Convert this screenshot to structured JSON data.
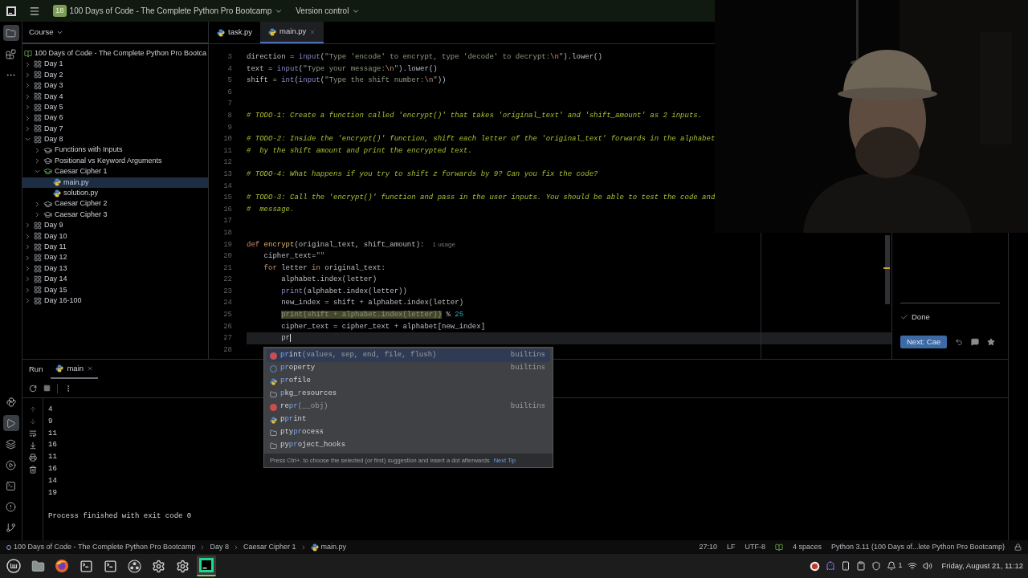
{
  "title_bar": {
    "project_badge": "18",
    "project": "100 Days of Code - The Complete Python Pro Bootcamp",
    "vcs": "Version control"
  },
  "left_rail": {
    "top": [
      {
        "kind": "project",
        "selected": true
      },
      {
        "kind": "structure",
        "selected": false
      },
      {
        "kind": "more",
        "selected": false
      }
    ],
    "bottom": [
      {
        "kind": "python-console",
        "selected": false
      },
      {
        "kind": "run",
        "selected": true
      },
      {
        "kind": "layers",
        "selected": false
      },
      {
        "kind": "services",
        "selected": false
      },
      {
        "kind": "terminal",
        "selected": false
      },
      {
        "kind": "problems",
        "selected": false
      },
      {
        "kind": "git",
        "selected": false
      }
    ]
  },
  "project_panel": {
    "title": "Course",
    "tree": [
      {
        "kind": "course",
        "label": "100 Days of Code - The Complete Python Pro Bootca",
        "selected": false,
        "children": [
          {
            "kind": "section",
            "label": "Day 1",
            "expanded": false,
            "selected": false
          },
          {
            "kind": "section",
            "label": "Day 2",
            "expanded": false,
            "selected": false
          },
          {
            "kind": "section",
            "label": "Day 3",
            "expanded": false,
            "selected": false
          },
          {
            "kind": "section",
            "label": "Day 4",
            "expanded": false,
            "selected": false
          },
          {
            "kind": "section",
            "label": "Day 5",
            "expanded": false,
            "selected": false
          },
          {
            "kind": "section",
            "label": "Day 6",
            "expanded": false,
            "selected": false
          },
          {
            "kind": "section",
            "label": "Day 7",
            "expanded": false,
            "selected": false
          },
          {
            "kind": "section",
            "label": "Day 8",
            "expanded": true,
            "selected": false,
            "children": [
              {
                "kind": "lesson",
                "label": "Functions with Inputs",
                "expanded": false,
                "solved": false,
                "selected": false
              },
              {
                "kind": "lesson",
                "label": "Positional vs Keyword Arguments",
                "expanded": false,
                "solved": false,
                "selected": false
              },
              {
                "kind": "lesson",
                "label": "Caesar Cipher 1",
                "expanded": true,
                "solved": true,
                "selected": false,
                "children": [
                  {
                    "kind": "file",
                    "label": "main.py",
                    "selected": true
                  },
                  {
                    "kind": "file",
                    "label": "solution.py",
                    "selected": false
                  }
                ]
              },
              {
                "kind": "lesson",
                "label": "Caesar Cipher 2",
                "expanded": false,
                "solved": false,
                "selected": false
              },
              {
                "kind": "lesson",
                "label": "Caesar Cipher 3",
                "expanded": false,
                "solved": false,
                "selected": false
              }
            ]
          },
          {
            "kind": "section",
            "label": "Day 9",
            "expanded": false,
            "selected": false
          },
          {
            "kind": "section",
            "label": "Day 10",
            "expanded": false,
            "selected": false
          },
          {
            "kind": "section",
            "label": "Day 11",
            "expanded": false,
            "selected": false
          },
          {
            "kind": "section",
            "label": "Day 12",
            "expanded": false,
            "selected": false
          },
          {
            "kind": "section",
            "label": "Day 13",
            "expanded": false,
            "selected": false
          },
          {
            "kind": "section",
            "label": "Day 14",
            "expanded": false,
            "selected": false
          },
          {
            "kind": "section",
            "label": "Day 15",
            "expanded": false,
            "selected": false
          },
          {
            "kind": "section",
            "label": "Day 16-100",
            "expanded": false,
            "selected": false
          }
        ]
      }
    ]
  },
  "editor": {
    "tabs": [
      {
        "label": "task.py",
        "selected": false
      },
      {
        "label": "main.py",
        "selected": true
      }
    ],
    "lines": [
      {
        "number": "3",
        "current": false,
        "tokens": [
          {
            "text": "direction = ",
            "kind": "plain"
          },
          {
            "text": "input",
            "kind": "builtin"
          },
          {
            "text": "(",
            "kind": "plain"
          },
          {
            "text": "\"Type 'encode' to encrypt, type 'decode' to decrypt:",
            "kind": "string"
          },
          {
            "text": "\\n",
            "kind": "escape"
          },
          {
            "text": "\"",
            "kind": "string"
          },
          {
            "text": ").lower()",
            "kind": "plain"
          }
        ]
      },
      {
        "number": "4",
        "current": false,
        "tokens": [
          {
            "text": "text = ",
            "kind": "plain"
          },
          {
            "text": "input",
            "kind": "builtin"
          },
          {
            "text": "(",
            "kind": "plain"
          },
          {
            "text": "\"Type your message:",
            "kind": "string"
          },
          {
            "text": "\\n",
            "kind": "escape"
          },
          {
            "text": "\"",
            "kind": "string"
          },
          {
            "text": ").lower()",
            "kind": "plain"
          }
        ]
      },
      {
        "number": "5",
        "current": false,
        "tokens": [
          {
            "text": "shift = ",
            "kind": "plain"
          },
          {
            "text": "int",
            "kind": "builtin"
          },
          {
            "text": "(",
            "kind": "plain"
          },
          {
            "text": "input",
            "kind": "builtin"
          },
          {
            "text": "(",
            "kind": "plain"
          },
          {
            "text": "\"Type the shift number:",
            "kind": "string"
          },
          {
            "text": "\\n",
            "kind": "escape"
          },
          {
            "text": "\"",
            "kind": "string"
          },
          {
            "text": "))",
            "kind": "plain"
          }
        ]
      },
      {
        "number": "6",
        "current": false
      },
      {
        "number": "7",
        "current": false
      },
      {
        "number": "8",
        "current": false,
        "tokens": [
          {
            "text": "# TODO-1: Create a function called 'encrypt()' that takes 'original_text' and 'shift_amount' as 2 inputs.",
            "kind": "comment"
          }
        ]
      },
      {
        "number": "9",
        "current": false
      },
      {
        "number": "10",
        "current": false,
        "tokens": [
          {
            "text": "# TODO-2: Inside the 'encrypt()' function, shift each letter of the 'original_text' forwards in the alphabet",
            "kind": "comment"
          }
        ]
      },
      {
        "number": "11",
        "current": false,
        "tokens": [
          {
            "text": "#  by the shift amount and print the encrypted text.",
            "kind": "comment"
          }
        ]
      },
      {
        "number": "12",
        "current": false
      },
      {
        "number": "13",
        "current": false,
        "tokens": [
          {
            "text": "# TODO-4: What happens if you try to shift z forwards by 9? Can you fix the code?",
            "kind": "comment"
          }
        ]
      },
      {
        "number": "14",
        "current": false
      },
      {
        "number": "15",
        "current": false,
        "tokens": [
          {
            "text": "# TODO-3: Call the 'encrypt()' function and pass in the user inputs. You should be able to test the code and",
            "kind": "comment"
          }
        ]
      },
      {
        "number": "16",
        "current": false,
        "tokens": [
          {
            "text": "#  message.",
            "kind": "comment"
          }
        ]
      },
      {
        "number": "17",
        "current": false
      },
      {
        "number": "18",
        "current": false
      },
      {
        "number": "19",
        "current": false,
        "tokens": [
          {
            "text": "def",
            "kind": "keyword"
          },
          {
            "text": " encrypt",
            "kind": "defname"
          },
          {
            "text": "(original_text, shift_amount):",
            "kind": "plain"
          },
          {
            "text": "1 usage",
            "kind": "hint"
          }
        ]
      },
      {
        "number": "20",
        "current": false,
        "tokens": [
          {
            "text": "    cipher_text=",
            "kind": "plain"
          },
          {
            "text": "\"\"",
            "kind": "string"
          }
        ]
      },
      {
        "number": "21",
        "current": false,
        "tokens": [
          {
            "text": "    for",
            "kind": "keyword"
          },
          {
            "text": " letter ",
            "kind": "plain"
          },
          {
            "text": "in",
            "kind": "keyword"
          },
          {
            "text": " original_text:",
            "kind": "plain"
          }
        ]
      },
      {
        "number": "22",
        "current": false,
        "tokens": [
          {
            "text": "        alphabet.index(letter)",
            "kind": "plain"
          }
        ]
      },
      {
        "number": "23",
        "current": false,
        "tokens": [
          {
            "text": "        print",
            "kind": "builtin"
          },
          {
            "text": "(alphabet.index(letter))",
            "kind": "plain"
          }
        ]
      },
      {
        "number": "24",
        "current": false,
        "tokens": [
          {
            "text": "        new_index = shift + alphabet.index(letter)",
            "kind": "plain"
          }
        ]
      },
      {
        "number": "25",
        "current": false,
        "tokens": [
          {
            "text": "        print(shift + alphabet.index(letter))",
            "kind": "warning"
          },
          {
            "text": " % ",
            "kind": "plain"
          },
          {
            "text": "25",
            "kind": "number"
          }
        ]
      },
      {
        "number": "26",
        "current": false,
        "tokens": [
          {
            "text": "        cipher_text = cipher_text + alphabet[new_index]",
            "kind": "plain"
          }
        ]
      },
      {
        "number": "27",
        "current": true,
        "tokens": [
          {
            "text": "        pr",
            "kind": "plain"
          }
        ]
      },
      {
        "number": "28",
        "current": false
      }
    ]
  },
  "completion": {
    "items": [
      {
        "kind": "function",
        "selected": true,
        "parts": [
          {
            "text": "pr",
            "match": true
          },
          {
            "text": "int",
            "match": false
          }
        ],
        "params": "(values, sep, end, file, flush)",
        "source": "builtins"
      },
      {
        "kind": "class",
        "selected": false,
        "parts": [
          {
            "text": "pr",
            "match": true
          },
          {
            "text": "operty",
            "match": false
          }
        ],
        "source": "builtins"
      },
      {
        "kind": "module",
        "selected": false,
        "parts": [
          {
            "text": "pr",
            "match": true
          },
          {
            "text": "ofile",
            "match": false
          }
        ]
      },
      {
        "kind": "package",
        "selected": false,
        "parts": [
          {
            "text": "p",
            "match": true
          },
          {
            "text": "kg_",
            "match": false
          },
          {
            "text": "r",
            "match": true
          },
          {
            "text": "esources",
            "match": false
          }
        ]
      },
      {
        "kind": "function",
        "selected": false,
        "parts": [
          {
            "text": "re",
            "match": false
          },
          {
            "text": "pr",
            "match": true
          }
        ],
        "params": "(__obj)",
        "source": "builtins"
      },
      {
        "kind": "module",
        "selected": false,
        "parts": [
          {
            "text": "p",
            "match": false
          },
          {
            "text": "pr",
            "match": true
          },
          {
            "text": "int",
            "match": false
          }
        ]
      },
      {
        "kind": "package",
        "selected": false,
        "parts": [
          {
            "text": "pty",
            "match": false
          },
          {
            "text": "pr",
            "match": true
          },
          {
            "text": "ocess",
            "match": false
          }
        ]
      },
      {
        "kind": "package",
        "selected": false,
        "parts": [
          {
            "text": "py",
            "match": false
          },
          {
            "text": "pr",
            "match": true
          },
          {
            "text": "oject_hooks",
            "match": false
          }
        ]
      }
    ],
    "hint": "Press Ctrl+. to choose the selected (or first) suggestion and insert a dot afterwards",
    "next_tip": "Next Tip"
  },
  "task_panel": {
    "status": "Done",
    "next_button": "Next: Cae"
  },
  "run_panel": {
    "title": "Run",
    "tab": "main",
    "output": [
      "4",
      "9",
      "11",
      "16",
      "11",
      "16",
      "14",
      "19"
    ],
    "exit_message": "Process finished with exit code 0"
  },
  "status_bar": {
    "breadcrumbs": [
      {
        "kind": "course",
        "label": "100 Days of Code - The Complete Python Pro Bootcamp"
      },
      {
        "kind": "section",
        "label": "Day 8"
      },
      {
        "kind": "lesson",
        "label": "Caesar Cipher 1"
      },
      {
        "kind": "file",
        "label": "main.py"
      }
    ],
    "position": "27:10",
    "line_ending": "LF",
    "encoding": "UTF-8",
    "indent": "4 spaces",
    "interpreter": "Python 3.11 (100 Days of...lete Python Pro Bootcamp)"
  },
  "taskbar": {
    "apps": [
      {
        "kind": "menu",
        "selected": false
      },
      {
        "kind": "files",
        "selected": false
      },
      {
        "kind": "browser",
        "selected": false
      },
      {
        "kind": "terminal",
        "selected": false
      },
      {
        "kind": "terminal",
        "selected": false
      },
      {
        "kind": "recorder",
        "selected": false
      },
      {
        "kind": "settings",
        "selected": false
      },
      {
        "kind": "settings",
        "selected": false
      },
      {
        "kind": "ide",
        "selected": true
      }
    ],
    "tray": [
      {
        "kind": "recorder"
      },
      {
        "kind": "chat"
      },
      {
        "kind": "phone"
      },
      {
        "kind": "clipboard"
      },
      {
        "kind": "shield"
      },
      {
        "kind": "updates",
        "label": "1"
      },
      {
        "kind": "wifi"
      },
      {
        "kind": "volume"
      }
    ],
    "clock": "Friday, August 21, 11:12"
  }
}
